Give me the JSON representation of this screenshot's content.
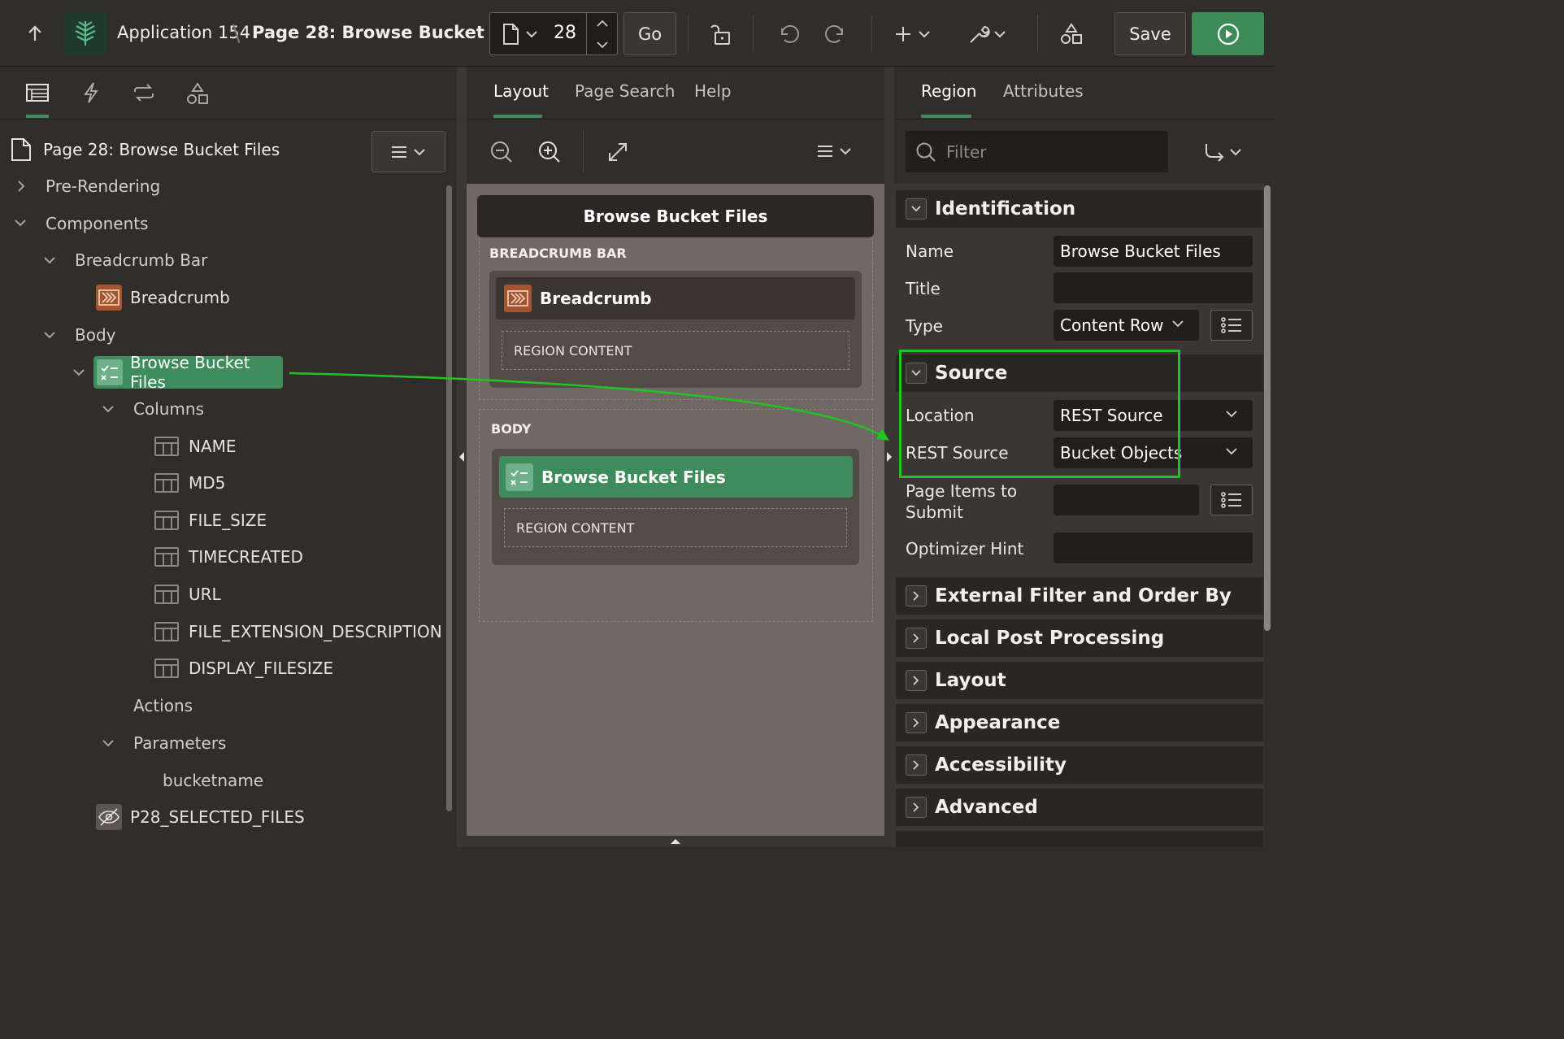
{
  "toolbar": {
    "app_name": "Application 154",
    "separator": "\\",
    "page_title": "Page 28: Browse Bucket Files",
    "page_number": "28",
    "go_label": "Go",
    "save_label": "Save"
  },
  "left_pane": {
    "page_node": "Page 28: Browse Bucket Files",
    "tree": {
      "pre_rendering": "Pre-Rendering",
      "components": "Components",
      "breadcrumb_bar": "Breadcrumb Bar",
      "breadcrumb": "Breadcrumb",
      "body": "Body",
      "region": "Browse Bucket Files",
      "columns": "Columns",
      "column_items": [
        "NAME",
        "MD5",
        "FILE_SIZE",
        "TIMECREATED",
        "URL",
        "FILE_EXTENSION_DESCRIPTION",
        "DISPLAY_FILESIZE"
      ],
      "actions": "Actions",
      "parameters": "Parameters",
      "param_bucketname": "bucketname",
      "hidden_item": "P28_SELECTED_FILES"
    }
  },
  "center_pane": {
    "tabs": [
      "Layout",
      "Page Search",
      "Help"
    ],
    "page_header": "Browse Bucket Files",
    "breadcrumb_bar_label": "BREADCRUMB BAR",
    "breadcrumb_region": "Breadcrumb",
    "region_content_1": "REGION CONTENT",
    "body_label": "BODY",
    "body_region": "Browse Bucket Files",
    "region_content_2": "REGION CONTENT"
  },
  "right_pane": {
    "tabs": [
      "Region",
      "Attributes"
    ],
    "filter_placeholder": "Filter",
    "identification": {
      "title": "Identification",
      "name_label": "Name",
      "name_value": "Browse Bucket Files",
      "title_label": "Title",
      "title_value": "",
      "type_label": "Type",
      "type_value": "Content Row"
    },
    "source": {
      "title": "Source",
      "location_label": "Location",
      "location_value": "REST Source",
      "rest_source_label": "REST Source",
      "rest_source_value": "Bucket Objects",
      "page_items_label_1": "Page Items to",
      "page_items_label_2": "Submit",
      "optimizer_label": "Optimizer Hint"
    },
    "collapsed_sections": [
      "External Filter and Order By",
      "Local Post Processing",
      "Layout",
      "Appearance",
      "Accessibility",
      "Advanced"
    ]
  },
  "colors": {
    "accent_green": "#3e8c5b",
    "run_green": "#3d8b57",
    "highlight_box": "#22c422",
    "breadcrumb_icon": "#a5542c"
  }
}
